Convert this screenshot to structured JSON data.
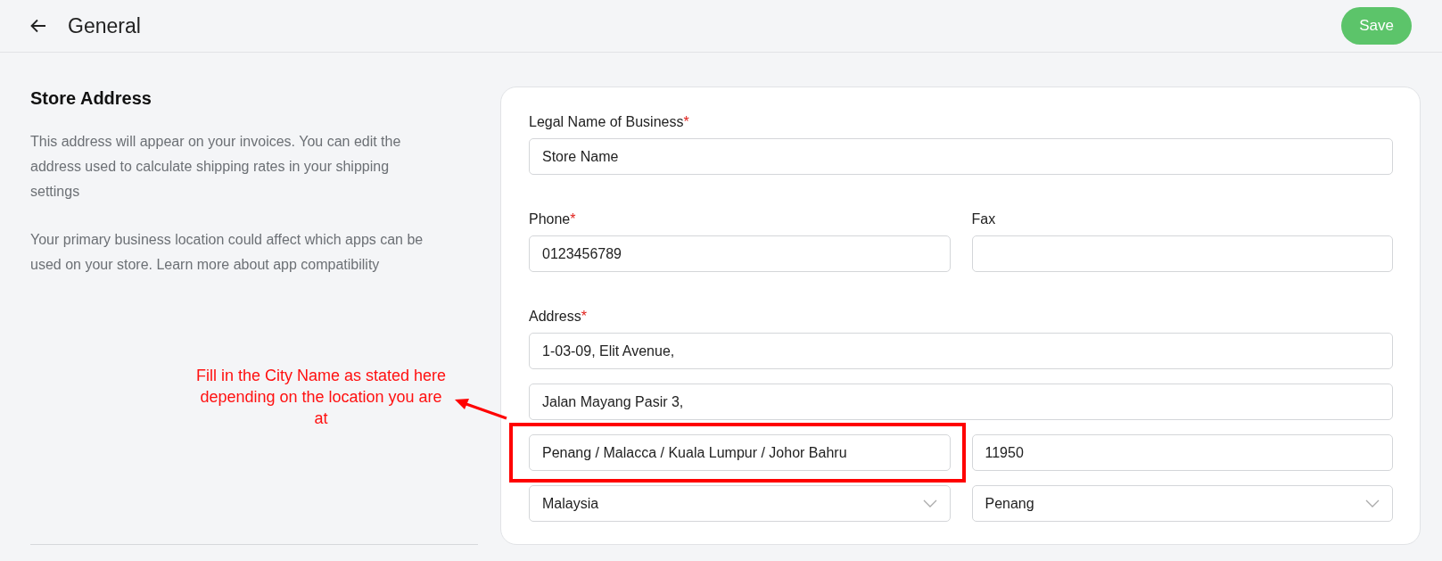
{
  "header": {
    "title": "General",
    "save_button": "Save"
  },
  "section": {
    "title": "Store Address",
    "paragraphs": [
      "This address will appear on your invoices. You can edit the address used to calculate shipping rates in your shipping settings",
      "Your primary business location could affect which apps can be used on your store. Learn more about app compatibility"
    ]
  },
  "form": {
    "rows": [
      {
        "label": "Legal Name of Business",
        "required_mark": "*",
        "fields": [
          {
            "kind": "text",
            "value": "Store Name"
          }
        ]
      },
      {
        "fields": [
          {
            "kind": "text",
            "label": "Phone",
            "required_mark": "*",
            "value": "0123456789"
          },
          {
            "kind": "text",
            "label": "Fax"
          }
        ]
      },
      {
        "label": "Address",
        "required_mark": "*",
        "fields": [
          {
            "kind": "text",
            "value": "1-03-09, Elit Avenue,"
          }
        ]
      },
      {
        "fields": [
          {
            "kind": "text",
            "value": "Jalan Mayang Pasir 3,"
          }
        ]
      },
      {
        "fields": [
          {
            "kind": "text",
            "value": "Penang / Malacca / Kuala Lumpur / Johor Bahru",
            "annotated": true
          },
          {
            "kind": "text",
            "value": "11950"
          }
        ]
      },
      {
        "fields": [
          {
            "kind": "select",
            "value": "Malaysia"
          },
          {
            "kind": "select",
            "value": "Penang"
          }
        ]
      }
    ]
  },
  "annotation": {
    "text": "Fill in the City Name as stated here depending on the location you are at"
  }
}
